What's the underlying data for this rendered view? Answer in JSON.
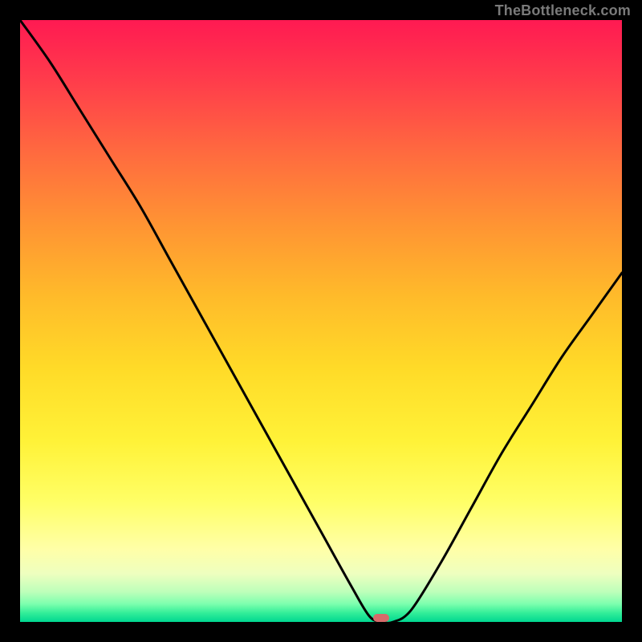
{
  "watermark": {
    "text": "TheBottleneck.com"
  },
  "colors": {
    "curve_stroke": "#000000",
    "marker_fill": "#d66a6a",
    "frame_bg": "#000000"
  },
  "chart_data": {
    "type": "line",
    "title": "",
    "xlabel": "",
    "ylabel": "",
    "xlim": [
      0,
      100
    ],
    "ylim": [
      0,
      100
    ],
    "grid": false,
    "legend": false,
    "series": [
      {
        "name": "bottleneck-curve",
        "x": [
          0,
          5,
          10,
          15,
          20,
          25,
          30,
          35,
          40,
          45,
          50,
          55,
          58,
          60,
          62,
          65,
          70,
          75,
          80,
          85,
          90,
          95,
          100
        ],
        "y": [
          100,
          93,
          85,
          77,
          69,
          60,
          51,
          42,
          33,
          24,
          15,
          6,
          1,
          0,
          0,
          2,
          10,
          19,
          28,
          36,
          44,
          51,
          58
        ]
      }
    ],
    "marker": {
      "x_pct": 60,
      "y_pct": 0
    }
  }
}
